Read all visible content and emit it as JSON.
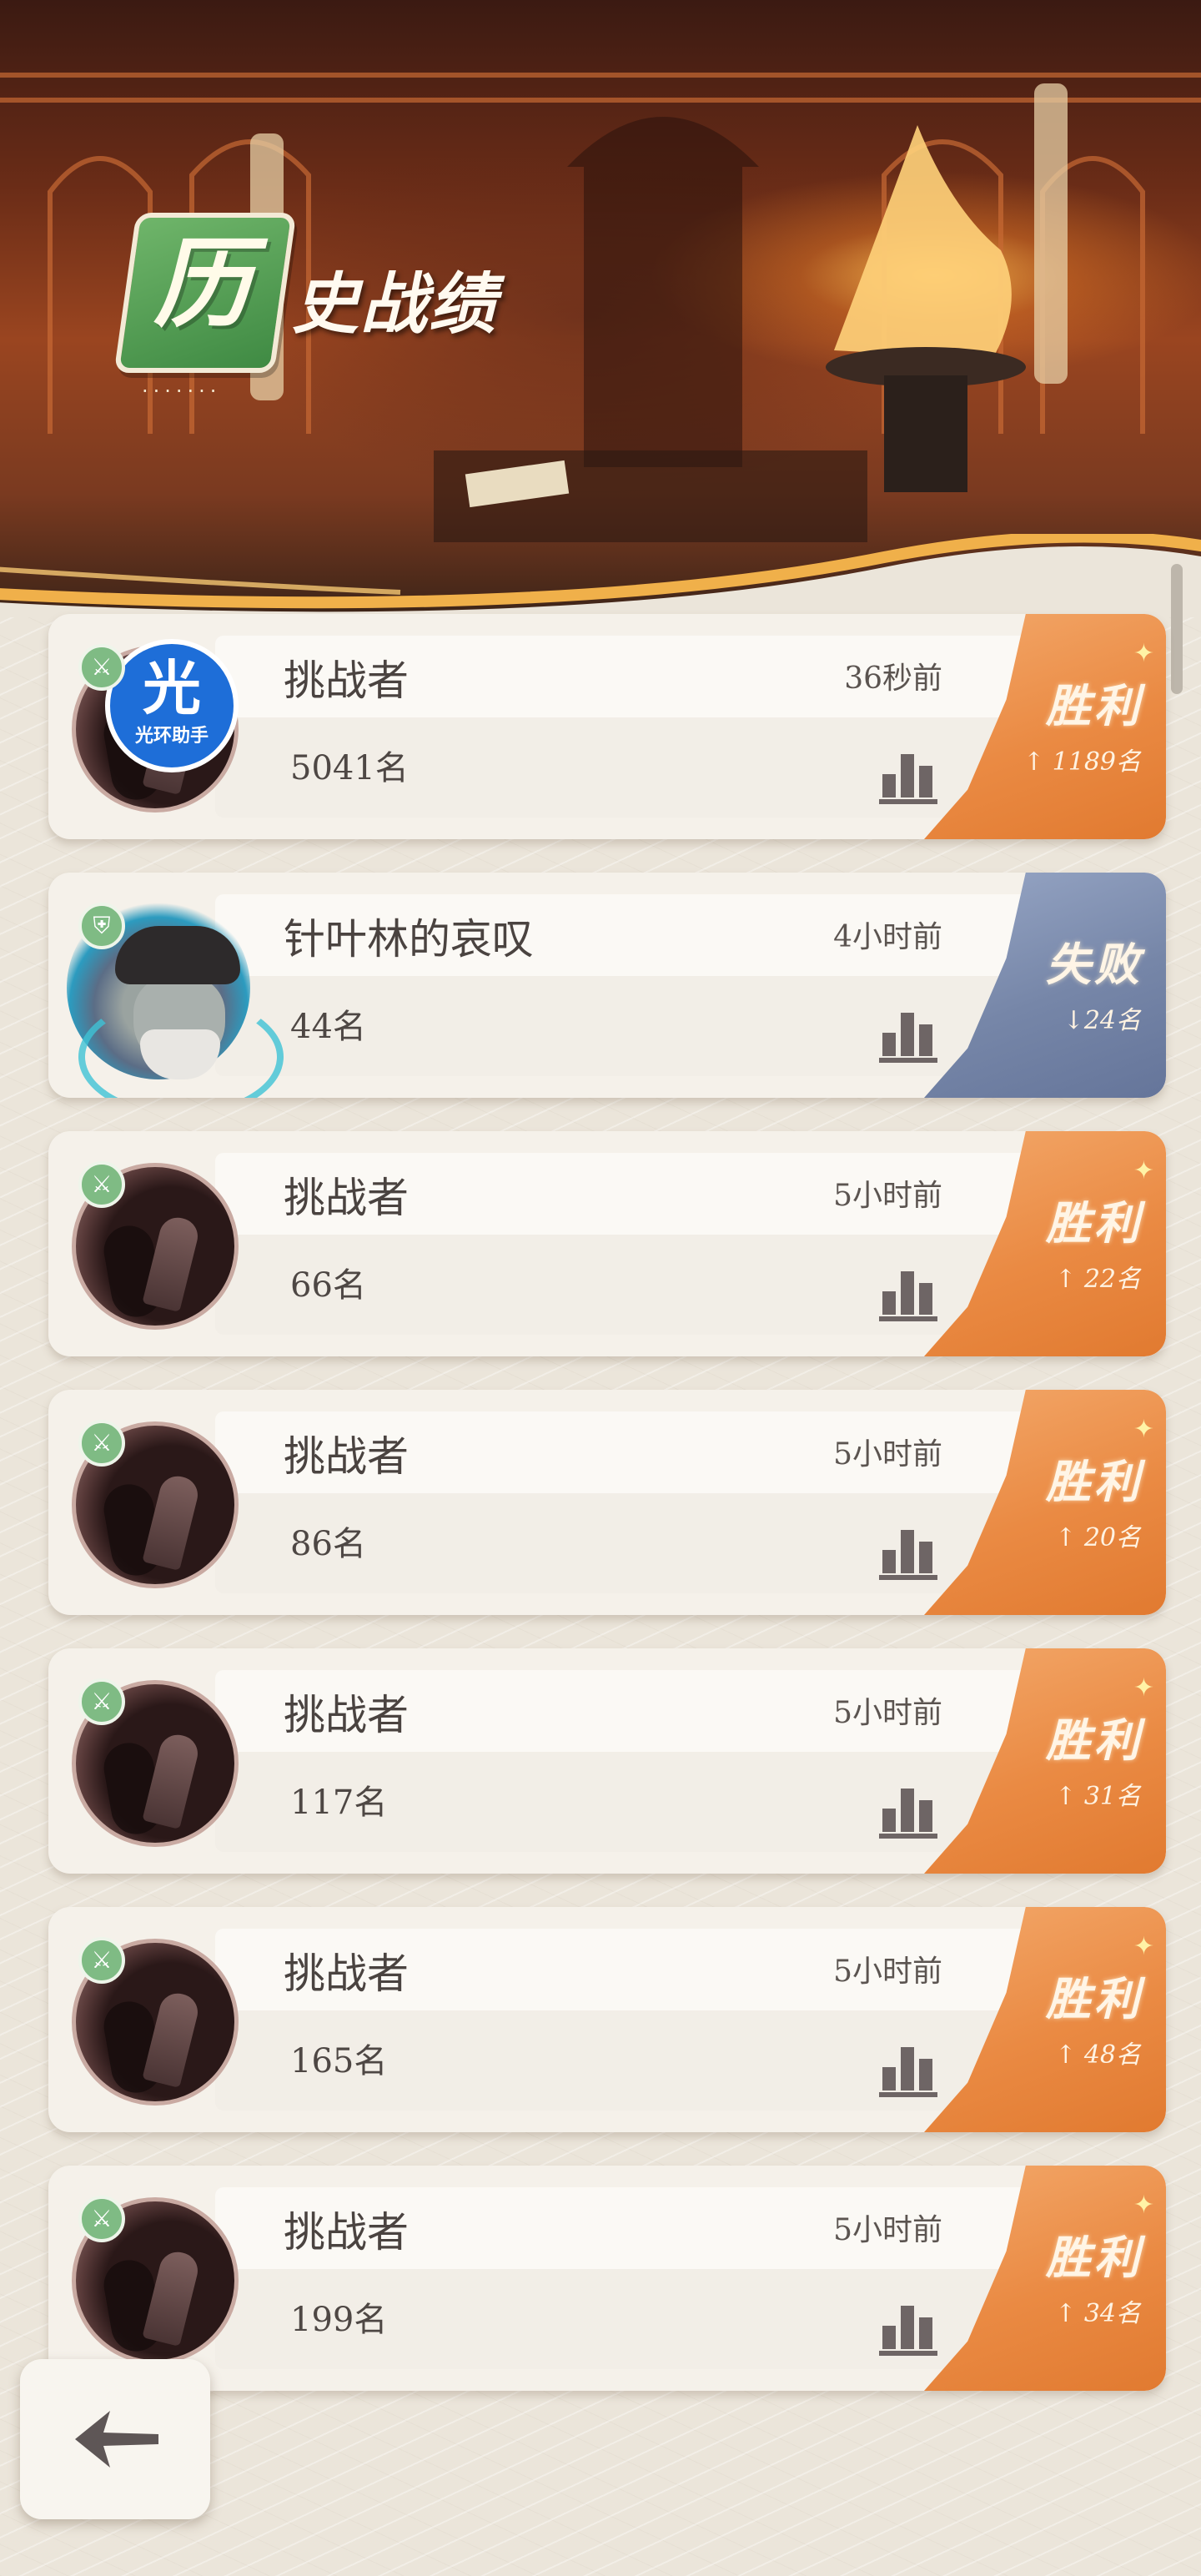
{
  "header": {
    "title_badge_char": "历",
    "title_rest": "史战绩",
    "dots": "·······"
  },
  "records": [
    {
      "name": "挑战者",
      "rank": "5041名",
      "time": "36秒前",
      "result": "胜利",
      "delta": "↑ 1189名",
      "outcome": "win",
      "avatar": "brand-logo",
      "logo_big": "光",
      "logo_small": "光环助手"
    },
    {
      "name": "针叶林的哀叹",
      "rank": "44名",
      "time": "4小时前",
      "result": "失败",
      "delta": "↓24名",
      "outcome": "lose",
      "avatar": "pirate"
    },
    {
      "name": "挑战者",
      "rank": "66名",
      "time": "5小时前",
      "result": "胜利",
      "delta": "↑ 22名",
      "outcome": "win",
      "avatar": "hood"
    },
    {
      "name": "挑战者",
      "rank": "86名",
      "time": "5小时前",
      "result": "胜利",
      "delta": "↑ 20名",
      "outcome": "win",
      "avatar": "hood"
    },
    {
      "name": "挑战者",
      "rank": "117名",
      "time": "5小时前",
      "result": "胜利",
      "delta": "↑ 31名",
      "outcome": "win",
      "avatar": "hood"
    },
    {
      "name": "挑战者",
      "rank": "165名",
      "time": "5小时前",
      "result": "胜利",
      "delta": "↑ 48名",
      "outcome": "win",
      "avatar": "hood"
    },
    {
      "name": "挑战者",
      "rank": "199名",
      "time": "5小时前",
      "result": "胜利",
      "delta": "↑ 34名",
      "outcome": "win",
      "avatar": "hood"
    }
  ],
  "icons": {
    "stats": "bar-chart-icon",
    "back": "back-arrow-icon",
    "role": "sword-badge-icon",
    "shield": "shield-badge-icon"
  },
  "colors": {
    "win": "#e8873f",
    "lose": "#7686a8",
    "badge_green": "#7fbb84",
    "title_green": "#4f9a4e"
  }
}
